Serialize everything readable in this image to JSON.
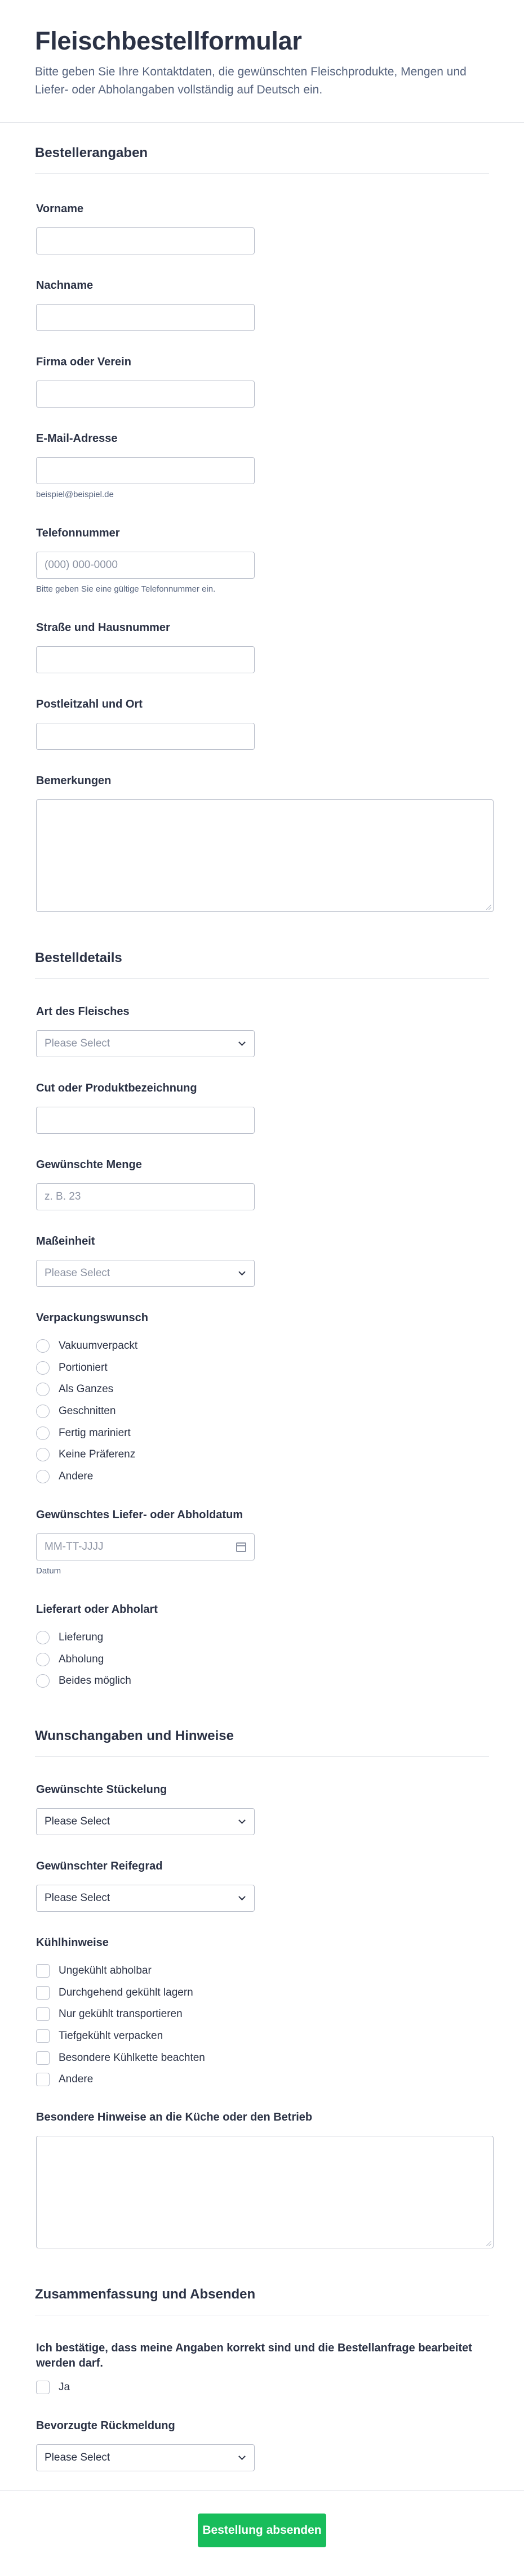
{
  "header": {
    "title": "Fleischbestellformular",
    "subtitle": "Bitte geben Sie Ihre Kontaktdaten, die gewünschten Fleischprodukte, Mengen und Liefer- oder Abholangaben vollständig auf Deutsch ein."
  },
  "sections": {
    "order_info": "Bestellerangaben",
    "order_details": "Bestelldetails",
    "wishes": "Wunschangaben und Hinweise",
    "summary": "Zusammenfassung und Absenden"
  },
  "contact": {
    "first_name": {
      "label": "Vorname",
      "value": ""
    },
    "last_name": {
      "label": "Nachname",
      "value": ""
    },
    "company": {
      "label": "Firma oder Verein",
      "value": ""
    },
    "email": {
      "label": "E-Mail-Adresse",
      "value": "",
      "sublabel": "beispiel@beispiel.de"
    },
    "phone": {
      "label": "Telefonnummer",
      "placeholder": "(000) 000-0000",
      "sublabel": "Bitte geben Sie eine gültige Telefonnummer ein."
    },
    "street": {
      "label": "Straße und Hausnummer",
      "value": ""
    },
    "zip_city": {
      "label": "Postleitzahl und Ort",
      "value": ""
    },
    "remarks": {
      "label": "Bemerkungen",
      "value": ""
    }
  },
  "details": {
    "meat_type": {
      "label": "Art des Fleisches",
      "placeholder": "Please Select"
    },
    "cut": {
      "label": "Cut oder Produktbezeichnung",
      "value": ""
    },
    "quantity": {
      "label": "Gewünschte Menge",
      "placeholder": "z. B. 23"
    },
    "unit": {
      "label": "Maßeinheit",
      "placeholder": "Please Select"
    },
    "packaging": {
      "label": "Verpackungswunsch",
      "options": [
        "Vakuumverpackt",
        "Portioniert",
        "Als Ganzes",
        "Geschnitten",
        "Fertig mariniert",
        "Keine Präferenz",
        "Andere"
      ]
    },
    "date": {
      "label": "Gewünschtes Liefer- oder Abholdatum",
      "placeholder": "MM-TT-JJJJ",
      "sublabel": "Datum"
    },
    "delivery": {
      "label": "Lieferart oder Abholart",
      "options": [
        "Lieferung",
        "Abholung",
        "Beides möglich"
      ]
    }
  },
  "wishes": {
    "pieces": {
      "label": "Gewünschte Stückelung",
      "value": "Please Select"
    },
    "ripeness": {
      "label": "Gewünschter Reifegrad",
      "value": "Please Select"
    },
    "cooling": {
      "label": "Kühlhinweise",
      "options": [
        "Ungekühlt abholbar",
        "Durchgehend gekühlt lagern",
        "Nur gekühlt transportieren",
        "Tiefgekühlt verpacken",
        "Besondere Kühlkette beachten",
        "Andere"
      ]
    },
    "notes": {
      "label": "Besondere Hinweise an die Küche oder den Betrieb",
      "value": ""
    }
  },
  "summary": {
    "confirm": {
      "label": "Ich bestätige, dass meine Angaben korrekt sind und die Bestellanfrage bearbeitet werden darf.",
      "option": "Ja"
    },
    "feedback": {
      "label": "Bevorzugte Rückmeldung",
      "value": "Please Select"
    }
  },
  "submit_label": "Bestellung absenden",
  "colors": {
    "accent": "#18bd5b",
    "text": "#2b3245",
    "muted": "#57647e",
    "border": "#b8bdc9"
  }
}
